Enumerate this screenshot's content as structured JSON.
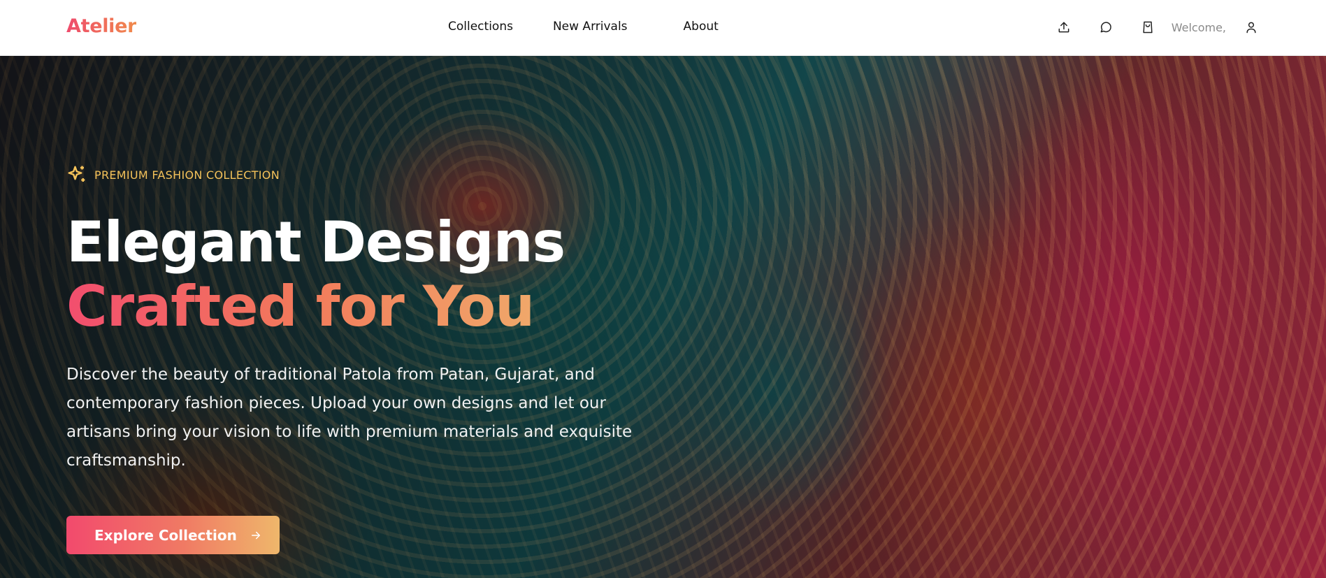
{
  "brand": {
    "name": "Atelier",
    "gradient_start": "#ef4b6c",
    "gradient_end": "#f08a4b"
  },
  "nav": {
    "links": [
      "Collections",
      "New Arrivals",
      "About"
    ],
    "icons": [
      "upload-icon",
      "message-icon",
      "shopping-bag-icon",
      "user-icon"
    ],
    "welcome_text": "Welcome,"
  },
  "hero": {
    "badge": {
      "icon": "sparkles-icon",
      "text": "PREMIUM FASHION COLLECTION",
      "color": "#f4c25a"
    },
    "headline_line1": "Elegant Designs",
    "headline_line2": "Crafted for You",
    "description": "Discover the beauty of traditional Patola from Patan, Gujarat, and contemporary fashion pieces. Upload your own designs and let our artisans bring your vision to life with premium materials and exquisite craftsmanship.",
    "cta": {
      "label": "Explore Collection",
      "icon": "arrow-right-icon",
      "gradient": [
        "#f24a6d",
        "#efb76b"
      ]
    },
    "background": "patterned-fabric-image"
  }
}
